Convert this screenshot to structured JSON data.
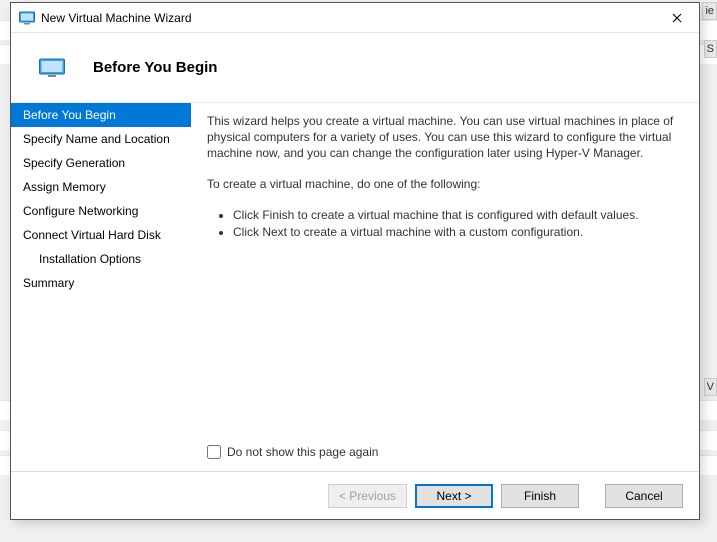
{
  "window": {
    "title": "New Virtual Machine Wizard"
  },
  "header": {
    "title": "Before You Begin"
  },
  "sidebar": {
    "steps": [
      "Before You Begin",
      "Specify Name and Location",
      "Specify Generation",
      "Assign Memory",
      "Configure Networking",
      "Connect Virtual Hard Disk",
      "Installation Options",
      "Summary"
    ]
  },
  "content": {
    "intro": "This wizard helps you create a virtual machine. You can use virtual machines in place of physical computers for a variety of uses. You can use this wizard to configure the virtual machine now, and you can change the configuration later using Hyper-V Manager.",
    "lead": "To create a virtual machine, do one of the following:",
    "bullets": [
      "Click Finish to create a virtual machine that is configured with default values.",
      "Click Next to create a virtual machine with a custom configuration."
    ],
    "checkbox_label": "Do not show this page again"
  },
  "footer": {
    "previous": "< Previous",
    "next": "Next >",
    "finish": "Finish",
    "cancel": "Cancel"
  }
}
